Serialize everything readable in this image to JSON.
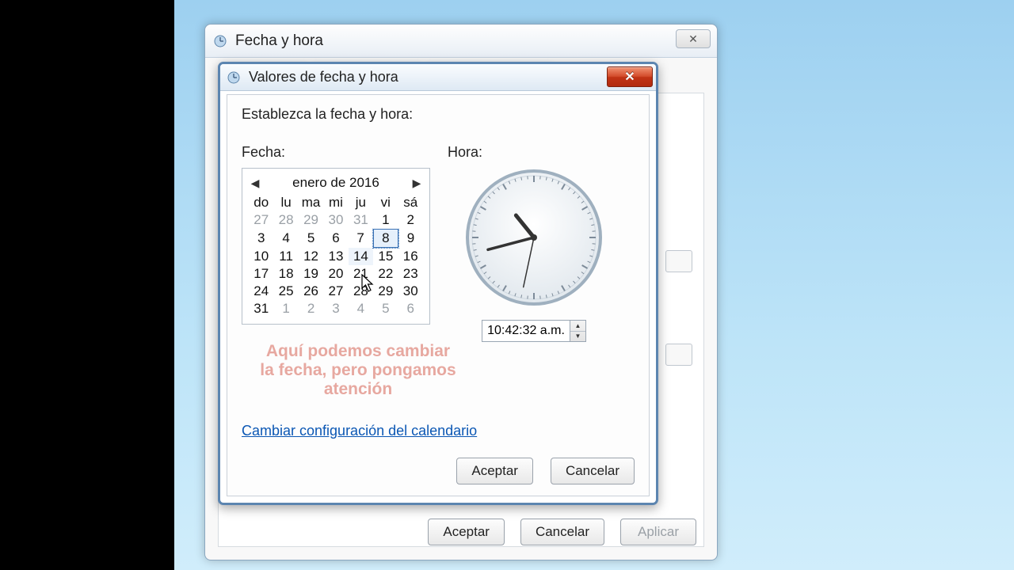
{
  "parent": {
    "title": "Fecha y hora",
    "buttons": {
      "ok": "Aceptar",
      "cancel": "Cancelar",
      "apply": "Aplicar"
    }
  },
  "child": {
    "title": "Valores de fecha y hora",
    "instruction": "Establezca la fecha y hora:",
    "date_label": "Fecha:",
    "time_label": "Hora:",
    "config_link": "Cambiar configuración del calendario",
    "buttons": {
      "ok": "Aceptar",
      "cancel": "Cancelar"
    }
  },
  "calendar": {
    "month_label": "enero de 2016",
    "weekdays": [
      "do",
      "lu",
      "ma",
      "mi",
      "ju",
      "vi",
      "sá"
    ],
    "weeks": [
      [
        {
          "d": 27,
          "o": true
        },
        {
          "d": 28,
          "o": true
        },
        {
          "d": 29,
          "o": true
        },
        {
          "d": 30,
          "o": true
        },
        {
          "d": 31,
          "o": true
        },
        {
          "d": 1
        },
        {
          "d": 2
        }
      ],
      [
        {
          "d": 3
        },
        {
          "d": 4
        },
        {
          "d": 5
        },
        {
          "d": 6
        },
        {
          "d": 7
        },
        {
          "d": 8,
          "sel": true
        },
        {
          "d": 9
        }
      ],
      [
        {
          "d": 10
        },
        {
          "d": 11
        },
        {
          "d": 12
        },
        {
          "d": 13
        },
        {
          "d": 14,
          "hov": true
        },
        {
          "d": 15
        },
        {
          "d": 16
        }
      ],
      [
        {
          "d": 17
        },
        {
          "d": 18
        },
        {
          "d": 19
        },
        {
          "d": 20
        },
        {
          "d": 21
        },
        {
          "d": 22
        },
        {
          "d": 23
        }
      ],
      [
        {
          "d": 24
        },
        {
          "d": 25
        },
        {
          "d": 26
        },
        {
          "d": 27
        },
        {
          "d": 28
        },
        {
          "d": 29
        },
        {
          "d": 30
        }
      ],
      [
        {
          "d": 31
        },
        {
          "d": 1,
          "o": true
        },
        {
          "d": 2,
          "o": true
        },
        {
          "d": 3,
          "o": true
        },
        {
          "d": 4,
          "o": true
        },
        {
          "d": 5,
          "o": true
        },
        {
          "d": 6,
          "o": true
        }
      ]
    ]
  },
  "clock": {
    "time_text": "10:42:32 a.m.",
    "hour": 10,
    "minute": 42,
    "second": 32
  },
  "overlay_note": "Aquí podemos cambiar la fecha, pero pongamos atención"
}
